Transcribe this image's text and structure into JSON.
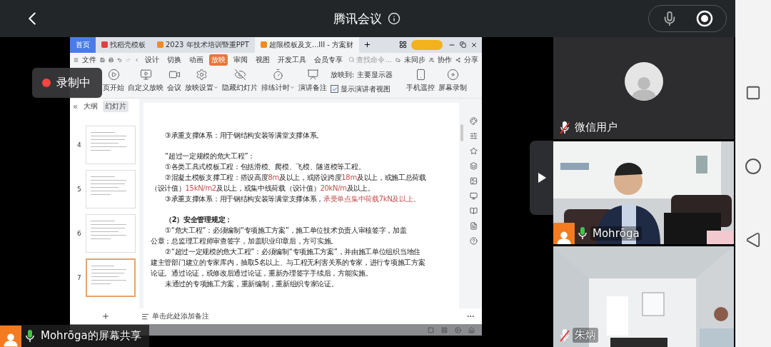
{
  "top_bar": {
    "title": "腾讯会议"
  },
  "recording": {
    "label": "录制中"
  },
  "shared_screen": {
    "caption": {
      "text": "Mohrōga的屏幕共享",
      "muted": false
    },
    "tabs": [
      {
        "label": "首页",
        "kind": "home",
        "selected": false
      },
      {
        "label": "找稻壳模板",
        "kind": "template",
        "selected": false
      },
      {
        "label": "2023 年技术培训暨重PPT",
        "kind": "document",
        "selected": false
      },
      {
        "label": "超限模板及支...III - 方案财",
        "kind": "document",
        "selected": true
      }
    ],
    "file_menu": "文件",
    "menu": [
      {
        "label": "设计",
        "selected": false
      },
      {
        "label": "切换",
        "selected": false
      },
      {
        "label": "动画",
        "selected": false
      },
      {
        "label": "放映",
        "selected": true
      },
      {
        "label": "审阅",
        "selected": false
      },
      {
        "label": "视图",
        "selected": false
      },
      {
        "label": "开发工具",
        "selected": false
      },
      {
        "label": "会员专享",
        "selected": false
      }
    ],
    "search": {
      "placeholder": "查找命令..."
    },
    "actions": [
      "未同步",
      "协作",
      "分享"
    ],
    "ribbon": [
      {
        "kind": "button",
        "label": "页开始",
        "dropdown": false
      },
      {
        "kind": "button",
        "label": "自定义放映",
        "dropdown": false
      },
      {
        "kind": "button",
        "label": "会议",
        "dropdown": false
      },
      {
        "kind": "button",
        "label": "放映设置",
        "dropdown": true
      },
      {
        "kind": "button",
        "label": "隐藏幻灯片",
        "dropdown": false
      },
      {
        "kind": "button",
        "label": "排练计时",
        "dropdown": true
      },
      {
        "kind": "button",
        "label": "演讲备注",
        "dropdown": false
      },
      {
        "kind": "group",
        "label": "放映到:",
        "value": "主要显示器",
        "option": {
          "label": "显示演讲者视图",
          "checked": true
        }
      },
      {
        "kind": "button",
        "label": "手机遥控",
        "dropdown": false
      },
      {
        "kind": "button",
        "label": "屏幕录制",
        "dropdown": false
      }
    ],
    "panel_tabs": [
      {
        "label": "大纲",
        "selected": false
      },
      {
        "label": "幻灯片",
        "selected": true
      }
    ],
    "slides": [
      {
        "number": "4",
        "selected": false
      },
      {
        "number": "5",
        "selected": false
      },
      {
        "number": "6",
        "selected": false
      },
      {
        "number": "7",
        "selected": true
      }
    ],
    "slide_lines": [
      {
        "kind": "indent",
        "parts": [
          {
            "text": "③承重支撑体系：用于钢结构安装等满堂支撑体系。",
            "highlight": false
          }
        ]
      },
      {
        "kind": "gap"
      },
      {
        "kind": "indent",
        "parts": [
          {
            "text": "“超过一定规模的危大工程”：",
            "highlight": false
          }
        ]
      },
      {
        "kind": "indent",
        "parts": [
          {
            "text": "①各类工具式模板工程：包括滑模、爬模、飞模、隧道模等工程。",
            "highlight": false
          }
        ]
      },
      {
        "kind": "indent",
        "parts": [
          {
            "text": "②混凝土模板支撑工程：搭设高度",
            "highlight": false
          },
          {
            "text": "8m",
            "highlight": true
          },
          {
            "text": "及以上，或搭设跨度",
            "highlight": false
          },
          {
            "text": "18m",
            "highlight": true
          },
          {
            "text": "及以上，或施工总荷载",
            "highlight": false
          }
        ]
      },
      {
        "kind": "plain",
        "parts": [
          {
            "text": "（设计值）",
            "highlight": false
          },
          {
            "text": "15kN/m2",
            "highlight": true
          },
          {
            "text": "及以上，或集中线荷载（设计值）",
            "highlight": false
          },
          {
            "text": "20kN/m",
            "highlight": true
          },
          {
            "text": "及以上。",
            "highlight": false
          }
        ]
      },
      {
        "kind": "indent",
        "parts": [
          {
            "text": "③承重支撑体系：用于钢结构安装等满堂支撑体系，",
            "highlight": false
          },
          {
            "text": "承受单点集中荷载7kN及以上。",
            "highlight": true
          }
        ]
      },
      {
        "kind": "gap"
      },
      {
        "kind": "heading",
        "parts": [
          {
            "text": "（2）安全管理规定：",
            "highlight": false
          }
        ]
      },
      {
        "kind": "indent",
        "parts": [
          {
            "text": "①“危大工程”：必须编制“专项施工方案”，施工单位技术负责人审核签字，加盖",
            "highlight": false
          }
        ]
      },
      {
        "kind": "plain",
        "parts": [
          {
            "text": "公章；总监理工程师审查签字，加盖职业印章后，方可实施。",
            "highlight": false
          }
        ]
      },
      {
        "kind": "indent",
        "parts": [
          {
            "text": "②“超过一定规模的危大工程”：必须编制“专项施工方案”，并由施工单位组织当地住",
            "highlight": false
          }
        ]
      },
      {
        "kind": "plain",
        "parts": [
          {
            "text": "建主管部门建立的专家库内，抽取5名以上、与工程无利害关系的专家，进行专项施工方案",
            "highlight": false
          }
        ]
      },
      {
        "kind": "plain",
        "parts": [
          {
            "text": "论证。通过论证，或修改后通过论证，重新办理签字手续后，方能实施。",
            "highlight": false
          }
        ]
      },
      {
        "kind": "indent",
        "parts": [
          {
            "text": "未通过的专项施工方案，重新编制，重新组织专家论证。",
            "highlight": false
          }
        ]
      }
    ],
    "notes_placeholder": "单击此处添加备注"
  },
  "participants": [
    {
      "name": "微信用户",
      "muted": true,
      "kind": "avatar",
      "avatar_badge": false
    },
    {
      "name": "Mohrōga",
      "muted": false,
      "kind": "video",
      "avatar_badge": true
    },
    {
      "name": "朱炳",
      "muted": true,
      "kind": "video",
      "avatar_badge": false
    }
  ]
}
